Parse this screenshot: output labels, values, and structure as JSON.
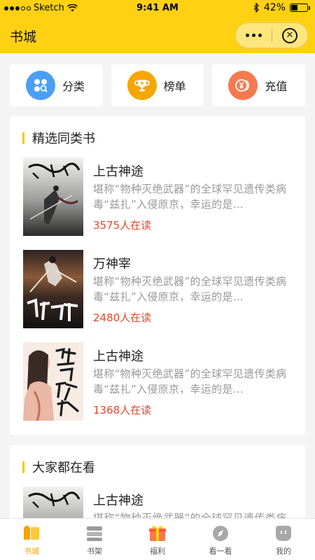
{
  "status_bar": {
    "carrier": "Sketch",
    "time": "9:41 AM",
    "battery": "42%",
    "battery_level": 0.42
  },
  "nav": {
    "title": "书城"
  },
  "quick_entries": [
    {
      "label": "分类",
      "icon": "category-icon",
      "color": "#4a9ff5"
    },
    {
      "label": "榜单",
      "icon": "trophy-icon",
      "color": "#f7a600"
    },
    {
      "label": "充值",
      "icon": "coin-icon",
      "color": "#f6794f"
    }
  ],
  "sections": [
    {
      "title": "精选同类书",
      "books": [
        {
          "title": "上古神途",
          "desc": "堪称“物种灭绝武器”的全球罕见遗传类病毒“兹扎”入侵原京，幸运的是…",
          "readers": "3575人在读"
        },
        {
          "title": "万神宰",
          "desc": "堪称“物种灭绝武器”的全球罕见遗传类病毒“兹扎”入侵原京，幸运的是…",
          "readers": "2480人在读"
        },
        {
          "title": "上古神途",
          "desc": "堪称“物种灭绝武器”的全球罕见遗传类病毒“兹扎”入侵原京，幸运的是…",
          "readers": "1368人在读"
        }
      ]
    },
    {
      "title": "大家都在看",
      "books": [
        {
          "title": "上古神途",
          "desc": "堪称“物种灭绝武器”的全球罕见遗传类病毒“兹扎”入侵原京，幸运的是…",
          "readers": ""
        }
      ]
    }
  ],
  "tabs": [
    {
      "label": "书城",
      "icon": "bookstore-icon",
      "active": true
    },
    {
      "label": "书架",
      "icon": "bookshelf-icon",
      "active": false
    },
    {
      "label": "福利",
      "icon": "gift-icon",
      "active": false
    },
    {
      "label": "看一看",
      "icon": "compass-icon",
      "active": false
    },
    {
      "label": "我的",
      "icon": "profile-icon",
      "active": false
    }
  ],
  "colors": {
    "brand_yellow": "#ffd112",
    "accent_red": "#e6462b",
    "active_tab": "#f5a400"
  }
}
